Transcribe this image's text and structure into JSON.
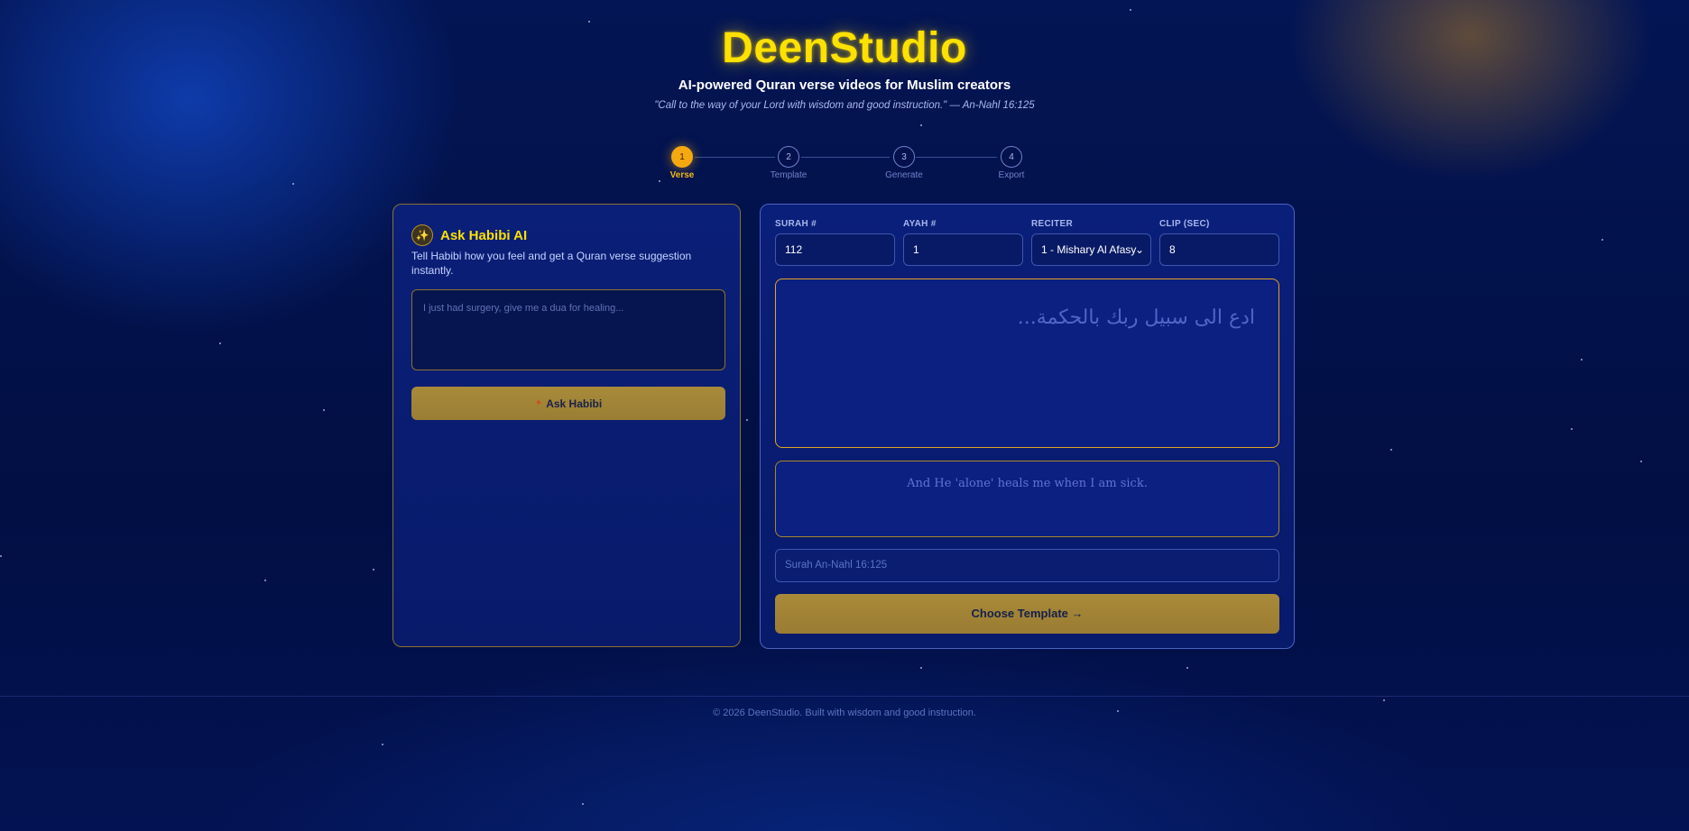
{
  "header": {
    "title": "DeenStudio",
    "subtitle": "AI-powered Quran verse videos for Muslim creators",
    "quote": "\"Call to the way of your Lord with wisdom and good instruction.\" — An-Nahl 16:125"
  },
  "steps": [
    {
      "number": "1",
      "label": "Verse",
      "active": true
    },
    {
      "number": "2",
      "label": "Template",
      "active": false
    },
    {
      "number": "3",
      "label": "Generate",
      "active": false
    },
    {
      "number": "4",
      "label": "Export",
      "active": false
    }
  ],
  "habibi": {
    "icon": "sparkles-icon",
    "title": "Ask Habibi AI",
    "description": "Tell Habibi how you feel and get a Quran verse suggestion instantly.",
    "input_placeholder": "I just had surgery, give me a dua for healing...",
    "button_label": "Ask Habibi"
  },
  "verse_form": {
    "surah_label": "SURAH #",
    "surah_value": "112",
    "ayah_label": "AYAH #",
    "ayah_value": "1",
    "reciter_label": "RECITER",
    "reciter_value": "1 - Mishary Al Afasy",
    "clip_label": "CLIP (SEC)",
    "clip_value": "8",
    "arabic_placeholder": "ادع الى سبيل ربك بالحكمة...",
    "translation_placeholder": "And He 'alone' heals me when I am sick.",
    "reference_placeholder": "Surah An-Nahl 16:125",
    "choose_button": "Choose Template →"
  },
  "footer": {
    "text": "© 2026 DeenStudio. Built with wisdom and good instruction."
  },
  "colors": {
    "background": "#03114d",
    "accent_gold": "#ffe100",
    "active_step": "#f5a810",
    "button_gold": "#a88a3a"
  }
}
